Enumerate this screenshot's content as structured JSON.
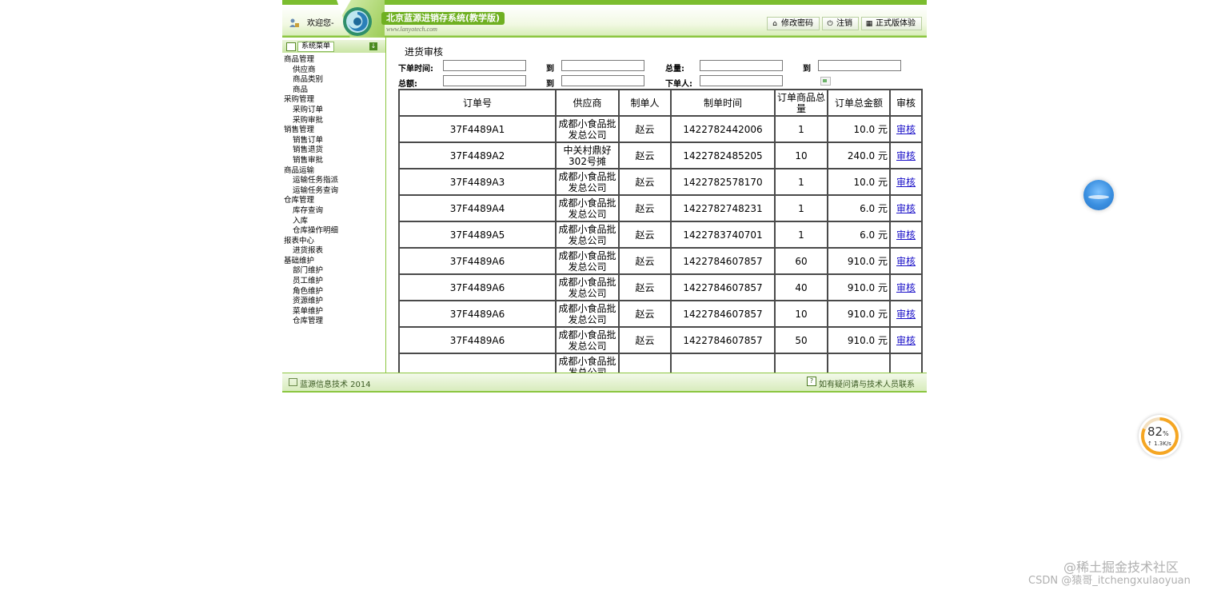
{
  "header": {
    "welcome": "欢迎您-",
    "system_title": "北京蓝源进销存系统(教学版)",
    "url": "www.lanyotech.com",
    "buttons": [
      {
        "label": "修改密码",
        "icon": "home-icon"
      },
      {
        "label": "注销",
        "icon": "power-icon"
      },
      {
        "label": "正式版体验",
        "icon": "grid-icon"
      }
    ]
  },
  "sidebar": {
    "title": "系统菜单",
    "items": [
      {
        "label": "商品管理",
        "level": 1
      },
      {
        "label": "供应商",
        "level": 2
      },
      {
        "label": "商品类别",
        "level": 2
      },
      {
        "label": "商品",
        "level": 2
      },
      {
        "label": "采购管理",
        "level": 1
      },
      {
        "label": "采购订单",
        "level": 2
      },
      {
        "label": "采购审批",
        "level": 2
      },
      {
        "label": "销售管理",
        "level": 1
      },
      {
        "label": "销售订单",
        "level": 2
      },
      {
        "label": "销售退货",
        "level": 2
      },
      {
        "label": "销售审批",
        "level": 2
      },
      {
        "label": "商品运输",
        "level": 1
      },
      {
        "label": "运输任务指派",
        "level": 2
      },
      {
        "label": "运输任务查询",
        "level": 2
      },
      {
        "label": "仓库管理",
        "level": 1
      },
      {
        "label": "库存查询",
        "level": 2
      },
      {
        "label": "入库",
        "level": 2
      },
      {
        "label": "仓库操作明细",
        "level": 2
      },
      {
        "label": "报表中心",
        "level": 1
      },
      {
        "label": "进货报表",
        "level": 2
      },
      {
        "label": "基础维护",
        "level": 1
      },
      {
        "label": "部门维护",
        "level": 2
      },
      {
        "label": "员工维护",
        "level": 2
      },
      {
        "label": "角色维护",
        "level": 2
      },
      {
        "label": "资源维护",
        "level": 2
      },
      {
        "label": "菜单维护",
        "level": 2
      },
      {
        "label": "仓库管理",
        "level": 2
      }
    ]
  },
  "main": {
    "title": "进货审核",
    "filters": {
      "order_time_label": "下单时间:",
      "to_label": "到",
      "quantity_label": "总量:",
      "amount_label": "总额:",
      "creator_label": "下单人:",
      "order_time_from": "",
      "order_time_to": "",
      "quantity_from": "",
      "quantity_to": "",
      "amount_from": "",
      "amount_to": "",
      "creator": ""
    },
    "table": {
      "headers": [
        "订单号",
        "供应商",
        "制单人",
        "制单时间",
        "订单商品总量",
        "订单总金额",
        "审核"
      ],
      "rows": [
        [
          "37F4489A1",
          "成都小食品批发总公司",
          "赵云",
          "1422782442006",
          "1",
          "10.0 元",
          "审核"
        ],
        [
          "37F4489A2",
          "中关村鼎好302号摊",
          "赵云",
          "1422782485205",
          "10",
          "240.0 元",
          "审核"
        ],
        [
          "37F4489A3",
          "成都小食品批发总公司",
          "赵云",
          "1422782578170",
          "1",
          "10.0 元",
          "审核"
        ],
        [
          "37F4489A4",
          "成都小食品批发总公司",
          "赵云",
          "1422782748231",
          "1",
          "6.0 元",
          "审核"
        ],
        [
          "37F4489A5",
          "成都小食品批发总公司",
          "赵云",
          "1422783740701",
          "1",
          "6.0 元",
          "审核"
        ],
        [
          "37F4489A6",
          "成都小食品批发总公司",
          "赵云",
          "1422784607857",
          "60",
          "910.0 元",
          "审核"
        ],
        [
          "37F4489A6",
          "成都小食品批发总公司",
          "赵云",
          "1422784607857",
          "40",
          "910.0 元",
          "审核"
        ],
        [
          "37F4489A6",
          "成都小食品批发总公司",
          "赵云",
          "1422784607857",
          "10",
          "910.0 元",
          "审核"
        ],
        [
          "37F4489A6",
          "成都小食品批发总公司",
          "赵云",
          "1422784607857",
          "50",
          "910.0 元",
          "审核"
        ],
        [
          "",
          "成都小食品批发总公司",
          "",
          "",
          "",
          "",
          ""
        ]
      ]
    }
  },
  "footer": {
    "left": "蓝源信息技术 2014",
    "right": "如有疑问请与技术人员联系"
  },
  "widgets": {
    "speed_percent": "82",
    "percent_sign": "%",
    "speed_rate": "↑ 1.3K/s"
  },
  "watermark": {
    "line1": "@稀土掘金技术社区",
    "line2": "CSDN @猿哥_itchengxulaoyuan"
  },
  "colors": {
    "brand_green": "#8bc63f",
    "link_blue": "#1a10c8"
  }
}
